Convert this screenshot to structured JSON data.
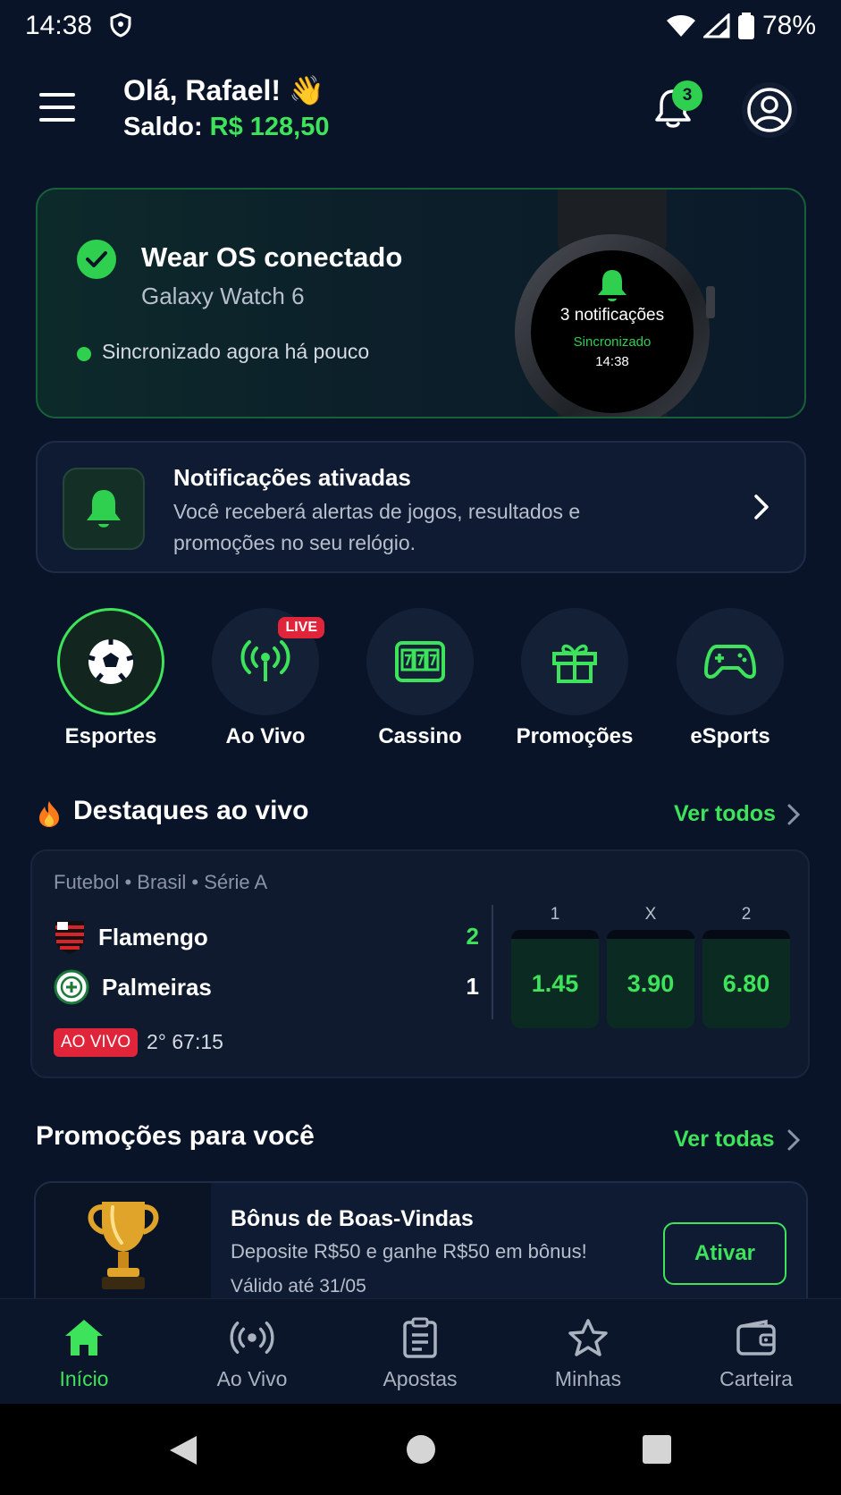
{
  "status_bar": {
    "time": "14:38",
    "battery": "78%"
  },
  "header": {
    "greeting": "Olá, Rafael! 👋",
    "balance_label": "Saldo: ",
    "balance_value": "R$ 128,50",
    "notification_count": "3"
  },
  "watch_card": {
    "title": "Wear OS conectado",
    "device": "Galaxy Watch 6",
    "sync_status": "Sincronizado agora há pouco",
    "face": {
      "notifications": "3 notificações",
      "status": "Sincronizado",
      "time": "14:38"
    }
  },
  "notifications_card": {
    "title": "Notificações ativadas",
    "body": "Você receberá alertas de jogos, resultados e promoções no seu relógio."
  },
  "categories": [
    {
      "label": "Esportes",
      "icon": "soccer-ball-icon",
      "active": true
    },
    {
      "label": "Ao Vivo",
      "icon": "broadcast-icon",
      "badge": "LIVE"
    },
    {
      "label": "Cassino",
      "icon": "slot-machine-icon"
    },
    {
      "label": "Promoções",
      "icon": "gift-icon"
    },
    {
      "label": "eSports",
      "icon": "gamepad-icon"
    }
  ],
  "live_section": {
    "title": "Destaques ao vivo",
    "link": "Ver todos",
    "match": {
      "league": "Futebol • Brasil • Série A",
      "home": {
        "name": "Flamengo",
        "score": "2"
      },
      "away": {
        "name": "Palmeiras",
        "score": "1"
      },
      "odds_headers": [
        "1",
        "X",
        "2"
      ],
      "odds": [
        "1.45",
        "3.90",
        "6.80"
      ],
      "live_tag": "AO VIVO",
      "clock": "2° 67:15"
    }
  },
  "promo_section": {
    "title": "Promoções para você",
    "link": "Ver todas",
    "promo": {
      "title": "Bônus de Boas-Vindas",
      "desc": "Deposite R$50 e ganhe R$50 em bônus!",
      "valid": "Válido até 31/05",
      "button": "Ativar"
    }
  },
  "bottom_nav": [
    {
      "label": "Início",
      "icon": "home-icon",
      "active": true
    },
    {
      "label": "Ao Vivo",
      "icon": "broadcast-icon"
    },
    {
      "label": "Apostas",
      "icon": "clipboard-icon"
    },
    {
      "label": "Minhas",
      "icon": "star-icon"
    },
    {
      "label": "Carteira",
      "icon": "wallet-icon"
    }
  ],
  "colors": {
    "accent": "#3de35a",
    "background": "#0a1428",
    "live": "#e0243a"
  }
}
